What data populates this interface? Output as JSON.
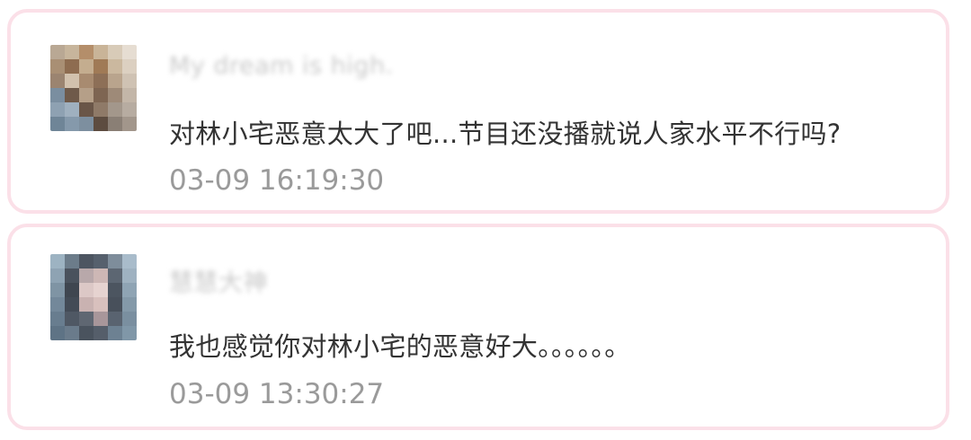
{
  "comments": [
    {
      "username": "My dream is high.",
      "text": "对林小宅恶意太大了吧...节目还没播就说人家水平不行吗?",
      "time": "03-09 16:19:30"
    },
    {
      "username": "慧慧大神",
      "text": "我也感觉你对林小宅的恶意好大。。。。。。",
      "time": "03-09 13:30:27"
    }
  ],
  "colors": {
    "card_border": "#fbe0e8",
    "text": "#333333",
    "timestamp": "#9a9a9a",
    "username_blurred": "#c9c9c9"
  },
  "icons": [
    "avatar-pixelated",
    "avatar-pixelated"
  ]
}
